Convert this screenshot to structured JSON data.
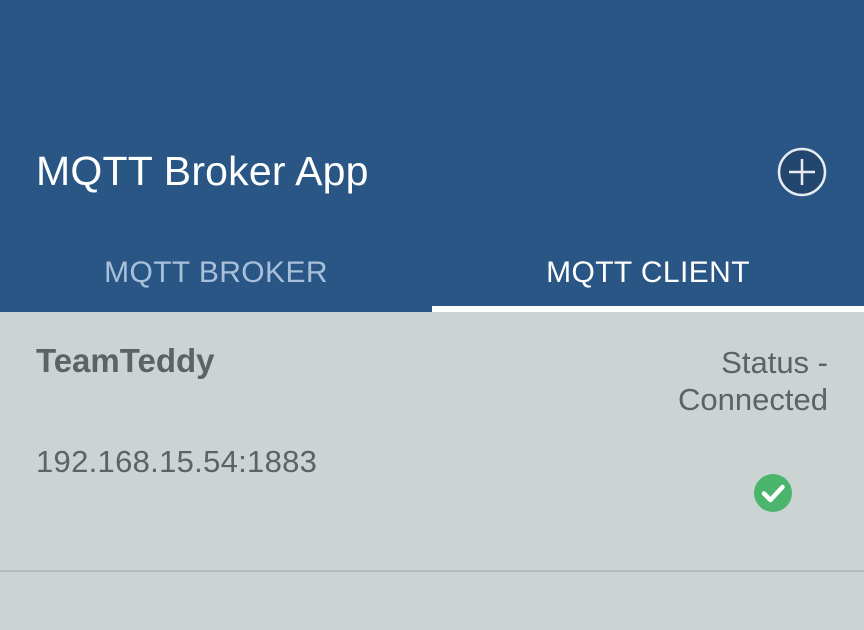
{
  "app": {
    "title": "MQTT Broker App"
  },
  "toolbar": {
    "add_icon": "plus-circle-icon"
  },
  "tabs": [
    {
      "label": "MQTT BROKER",
      "selected": false
    },
    {
      "label": "MQTT CLIENT",
      "selected": true
    }
  ],
  "clients": [
    {
      "name": "TeamTeddy",
      "address": "192.168.15.54:1883",
      "status_line1": "Status -",
      "status_line2": "Connected",
      "status_icon": "check-circle-icon",
      "status_color": "#4cb56d"
    }
  ],
  "colors": {
    "primary": "#2a5686",
    "tab_inactive": "#a9c0da",
    "background": "#ccd3d3"
  }
}
